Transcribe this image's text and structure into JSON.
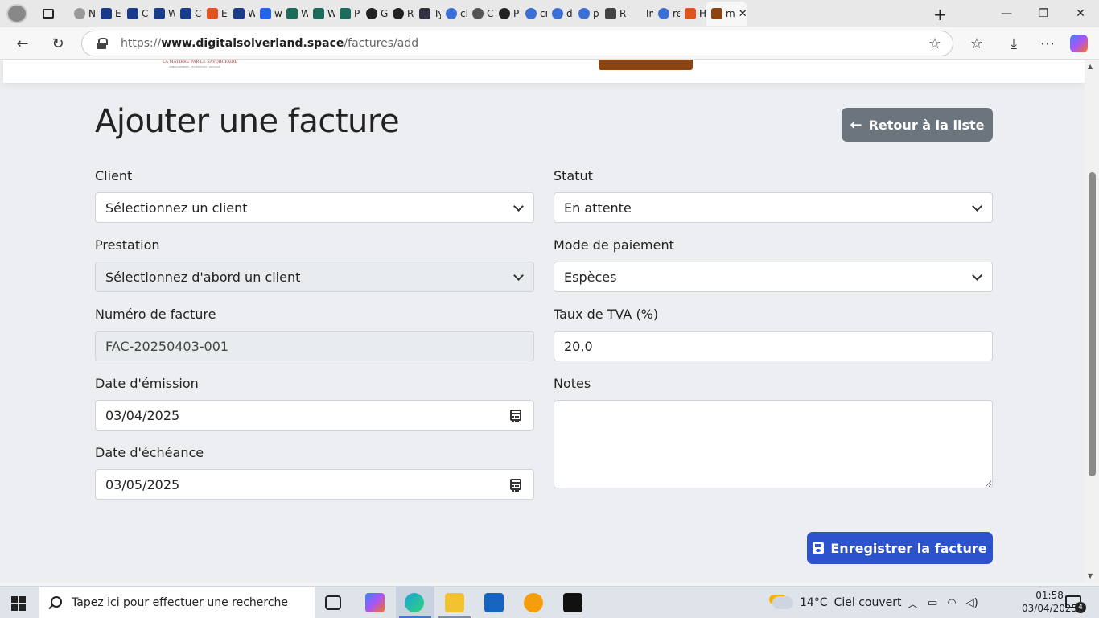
{
  "browser": {
    "tabs": [
      "N",
      "E",
      "C",
      "W",
      "C",
      "E",
      "W",
      "w",
      "W",
      "W",
      "P",
      "G",
      "R",
      "Ty",
      "cl",
      "C",
      "P",
      "cr",
      "d",
      "p",
      "R",
      "In",
      "re",
      "H",
      "m"
    ],
    "active_tab_close": "✕",
    "new_tab": "+",
    "url_prefix": "https://",
    "url_domain": "www.digitalsolverland.space",
    "url_path": "/factures/add"
  },
  "site_header": {
    "logo_text": "LA MATIERE PAR LE SAVOIR-FAIRE",
    "logo_sub": "AMENAGEMENTS - EXTERIEURS - PAYSAGE"
  },
  "page": {
    "title": "Ajouter une facture",
    "back_button": "Retour à la liste",
    "save_button": "Enregistrer la facture"
  },
  "form": {
    "client_label": "Client",
    "client_value": "Sélectionnez un client",
    "statut_label": "Statut",
    "statut_value": "En attente",
    "prestation_label": "Prestation",
    "prestation_value": "Sélectionnez d'abord un client",
    "mode_label": "Mode de paiement",
    "mode_value": "Espèces",
    "numero_label": "Numéro de facture",
    "numero_value": "FAC-20250403-001",
    "tva_label": "Taux de TVA (%)",
    "tva_value": "20,0",
    "emission_label": "Date d'émission",
    "emission_value": "03/04/2025",
    "notes_label": "Notes",
    "notes_value": "",
    "echeance_label": "Date d'échéance",
    "echeance_value": "03/05/2025"
  },
  "taskbar": {
    "search_placeholder": "Tapez ici pour effectuer une recherche",
    "weather_temp": "14°C",
    "weather_text": "Ciel couvert",
    "time": "01:58",
    "date": "03/04/2025",
    "notification_count": "4"
  },
  "colors": {
    "back_button": "#6c757d",
    "save_button": "#2c52cc",
    "header_button": "#8b4513"
  }
}
